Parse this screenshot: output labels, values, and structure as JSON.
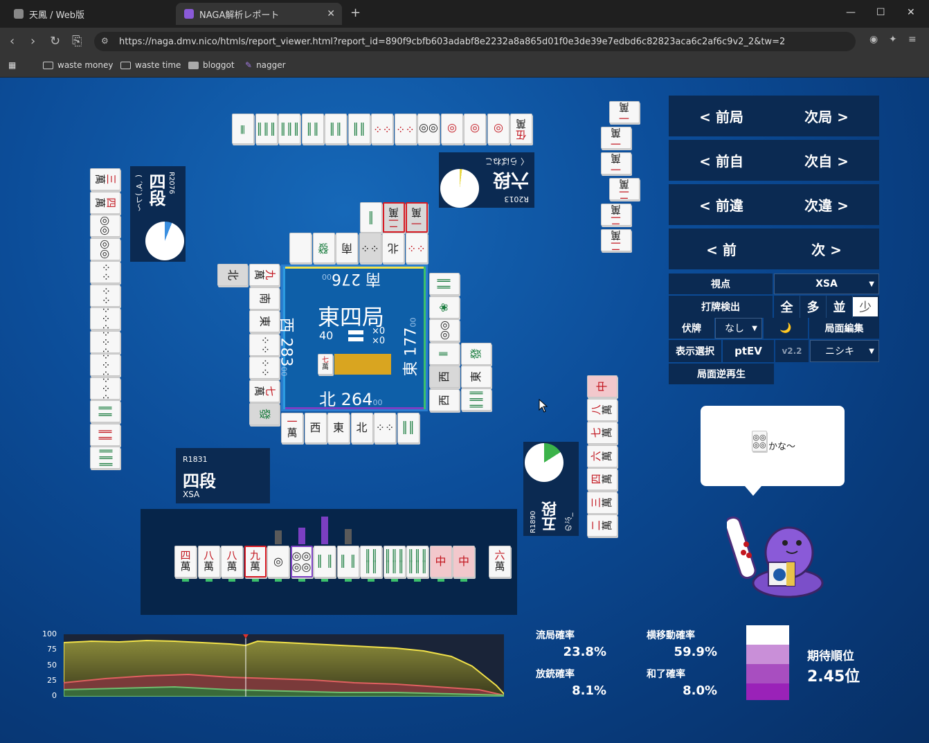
{
  "browser": {
    "tabs": [
      {
        "title": "天鳳 / Web版"
      },
      {
        "title": "NAGA解析レポート"
      }
    ],
    "url": "https://naga.dmv.nico/htmls/report_viewer.html?report_id=890f9cbfb603adabf8e2232a8a865d01f0e3de39e7edbd6c82823aca6c2af6c9v2_2&tw=2",
    "bookmarks": [
      "waste money",
      "waste time",
      "bloggot",
      "nagger"
    ]
  },
  "center": {
    "round": "東四局",
    "honba": "40",
    "sticks": "×0",
    "sticks2": "×0",
    "south": {
      "label": "南",
      "score": "276",
      "sub": "00"
    },
    "west": {
      "label": "西",
      "score": "283",
      "sub": "00"
    },
    "east": {
      "label": "東",
      "score": "177",
      "sub": "00"
    },
    "north": {
      "label": "北",
      "score": "264",
      "sub": "00"
    }
  },
  "players": {
    "top": {
      "rating": "R2013",
      "rank": "六段",
      "name": "〈 らばねこ"
    },
    "left": {
      "rating": "R2076",
      "rank": "四段",
      "name": "( ´∀`)レ〜"
    },
    "bottom": {
      "rating": "R1831",
      "rank": "四段",
      "name": "XSA"
    },
    "right": {
      "rating": "R1890",
      "rank": "五段",
      "name": "のぶ_"
    }
  },
  "controls": {
    "prev_round": "< 前局",
    "next_round": "次局 >",
    "prev_self": "< 前自",
    "next_self": "次自 >",
    "prev_diff": "< 前違",
    "next_diff": "次違 >",
    "prev": "< 前",
    "next": "次 >",
    "viewpoint_label": "視点",
    "viewpoint_value": "XSA",
    "detect_label": "打牌検出",
    "detect_opts": [
      "全",
      "多",
      "並",
      "少"
    ],
    "hidden_label": "伏牌",
    "hidden_value": "なし",
    "moon": "🌙",
    "edit": "局面編集",
    "display_label": "表示選択",
    "display_value": "ptEV",
    "version": "v2.2",
    "model_value": "ニシキ",
    "replay": "局面逆再生"
  },
  "speech": {
    "text": "かな〜"
  },
  "stats": {
    "ryuukyoku_label": "流局確率",
    "ryuukyoku": "23.8%",
    "yoko_label": "横移動確率",
    "yoko": "59.9%",
    "houjuu_label": "放銃確率",
    "houjuu": "8.1%",
    "agari_label": "和了確率",
    "agari": "8.0%",
    "expected_label": "期待順位",
    "expected": "2.45位"
  },
  "graph": {
    "yticks": [
      "100",
      "75",
      "50",
      "25",
      "0"
    ]
  },
  "colors": {
    "bg": "#0c4d99",
    "panel": "#0b2a52",
    "accent_yellow": "#f2e24a",
    "red": "#c2161f"
  }
}
